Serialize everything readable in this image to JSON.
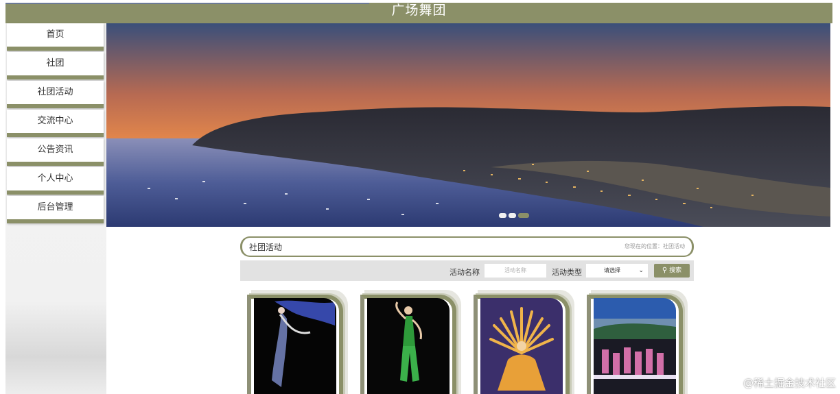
{
  "header": {
    "title": "广场舞团"
  },
  "sidebar": {
    "items": [
      {
        "label": "首页"
      },
      {
        "label": "社团"
      },
      {
        "label": "社团活动"
      },
      {
        "label": "交流中心"
      },
      {
        "label": "公告资讯"
      },
      {
        "label": "个人中心"
      },
      {
        "label": "后台管理"
      }
    ]
  },
  "breadcrumb": {
    "section": "社团活动",
    "location": "您现在的位置：社团活动"
  },
  "search": {
    "name_label": "活动名称",
    "name_placeholder": "活动名称",
    "type_label": "活动类型",
    "type_selected": "请选择",
    "button_label": "搜索"
  },
  "watermark": "@稀土掘金技术社区",
  "colors": {
    "accent": "#8b9068"
  }
}
